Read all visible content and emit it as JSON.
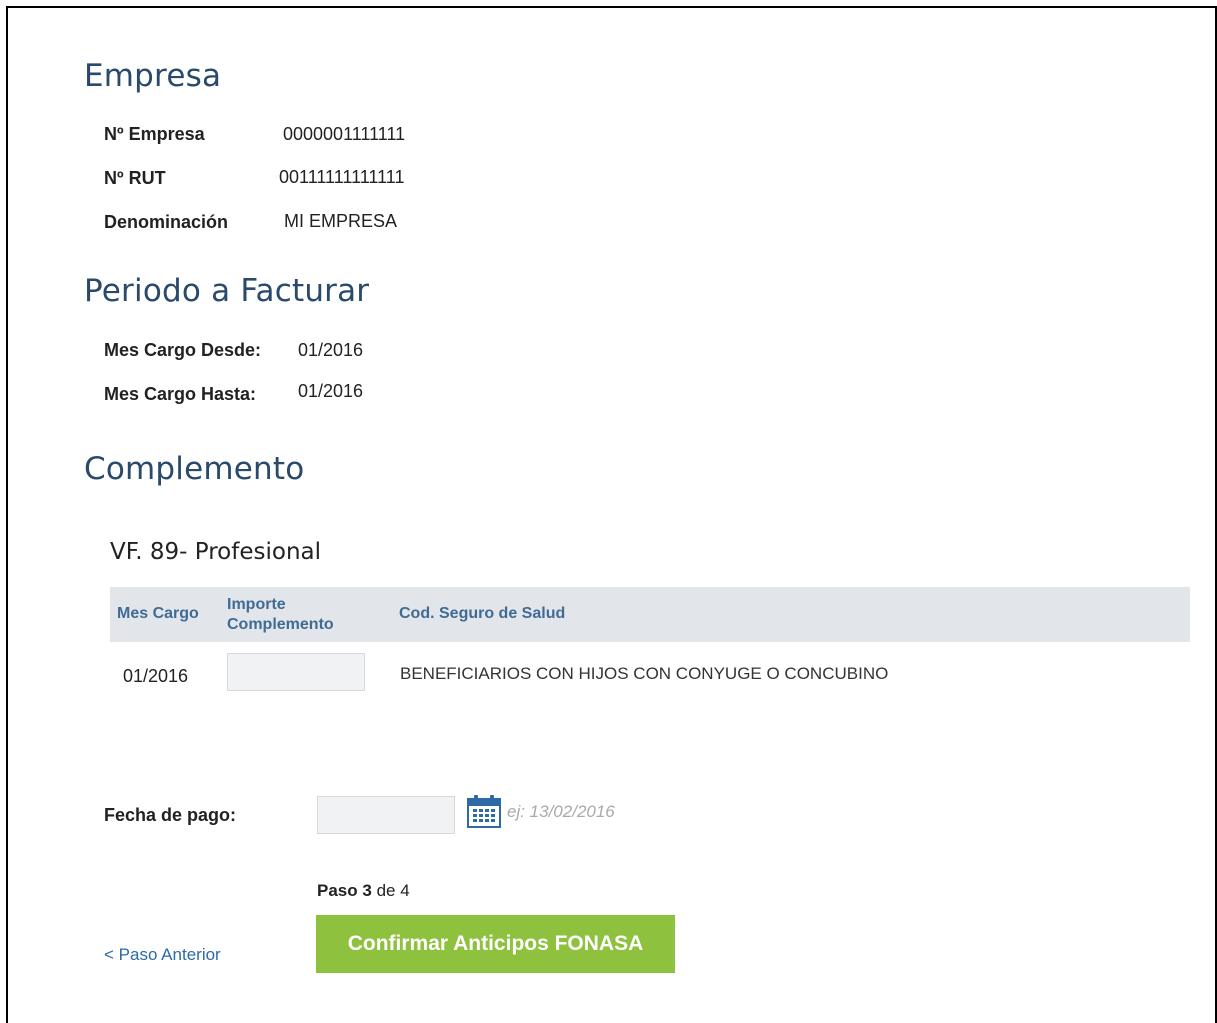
{
  "empresa": {
    "title": "Empresa",
    "fields": [
      {
        "label": "Nº Empresa",
        "value": "0000001111111"
      },
      {
        "label": "Nº RUT",
        "value": "00111111111111"
      },
      {
        "label": "Denominación",
        "value": "MI EMPRESA"
      }
    ]
  },
  "periodo": {
    "title": "Periodo a Facturar",
    "fields": [
      {
        "label": "Mes Cargo Desde:",
        "value": "01/2016"
      },
      {
        "label": "Mes Cargo Hasta:",
        "value": "01/2016"
      }
    ]
  },
  "complemento": {
    "title": "Complemento",
    "subtitle": "VF. 89- Profesional",
    "table": {
      "headers": [
        "Mes Cargo",
        "Importe Complemento",
        "Cod. Seguro de Salud"
      ],
      "rows": [
        {
          "mes_cargo": "01/2016",
          "importe": "",
          "cod_seguro": "BENEFICIARIOS CON HIJOS CON CONYUGE O CONCUBINO"
        }
      ]
    }
  },
  "fecha_pago": {
    "label": "Fecha de pago:",
    "value": "",
    "hint": "ej: 13/02/2016",
    "icon": "calendar-icon"
  },
  "paso": {
    "prefix": "Paso",
    "current": "3",
    "middle": "de",
    "total": "4"
  },
  "nav": {
    "back_label": "< Paso Anterior",
    "confirm_label": "Confirmar Anticipos FONASA"
  },
  "colors": {
    "heading": "#2a4a6b",
    "table_header_bg": "#e2e6ea",
    "table_header_text": "#3f6b94",
    "confirm_bg": "#8ec13d",
    "link": "#2c6aa8"
  }
}
